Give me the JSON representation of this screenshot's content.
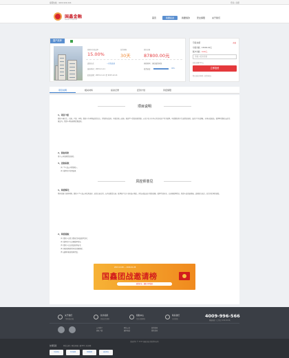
{
  "topbar": {
    "left": "客服热线：4009-996-566",
    "right": "登录 | 注册"
  },
  "brand": {
    "name": "国鑫金融",
    "sub": "Guoxin Financial"
  },
  "nav": [
    "首页",
    "我要投资",
    "我要借款",
    "安全保障",
    "关于我们"
  ],
  "product": {
    "tag": "国产抵押",
    "rate_label": "预期年化收益率",
    "rate": "15.00%",
    "term_label": "投资期限",
    "term": "30天",
    "amount_label": "借款金额",
    "amount": "87800.00元",
    "repay_label": "还款方式",
    "repay_value": "一次性还款",
    "guarantee_label": "担保机构：国信融资担保",
    "progress_label": "投资进度",
    "progress": 0.99,
    "progress_text": "99%",
    "release_label": "发布时间：2015-11-11",
    "date_range": "起息日期：2015-11-11 至 2015-12-11"
  },
  "invest": {
    "title": "可投余额",
    "recharge": "充值",
    "balance": "可投余额：15000.00元",
    "account_prefix": "账户余额：",
    "account_value": "0.00元",
    "placeholder": "请输入投资金额",
    "hint": "起投金额100元",
    "button": "立即投资",
    "agree": "我已阅读并同意《投资协议》"
  },
  "tabs": [
    "项目说明",
    "相关材料",
    "投资记录",
    "还款计划",
    "风控保障"
  ],
  "section1": {
    "title": "项目说明",
    "h1": "1、项目介绍",
    "p1": "借款人杨先生，已婚，户籍：本地。借款人为本地私营企业主，经营状况良好，有稳定收入来源。现因个人资金周转需要，以名下位于市中心的住宅房产作为抵押，申请借款用于生意资金周转。该房产产权清晰，市场价值较高，抵押率控制在安全范围之内，借款人承诺按期足额还款。",
    "h2": "2、资金用途",
    "p2": "用于公司短期资金周转。",
    "h3": "3、还款来源：",
    "r1": "(1) 个人及公司经营收入",
    "r2": "(2) 抵押房产处置变现"
  },
  "section2": {
    "title": "风控师意见",
    "h1": "1、风控情况：",
    "p1": "经风控部门实地考察，借款人个人及公司信用良好，征信记录正常，无不良借贷记录。抵押房产位于市区核心地段，评估价值远高于借款金额，抵押手续齐全，已办理抵押登记。借款人还款意愿强，还款能力充足，综合评定风险较低。",
    "h2": "2、风控措施：",
    "c1": "(1) 借款人已签订借款合同及抵押合同；",
    "c2": "(2) 抵押房产已办理抵押登记；",
    "c3": "(3) 借款人已出具还款承诺书；",
    "c4": "(4) 担保机构提供本息全额担保；",
    "c5": "(5) 逾期时担保机构代偿。"
  },
  "banner": {
    "date": "2015.12.08 — 2016.01.08",
    "text": "国鑫团战邀请榜",
    "sub": "邀请好友 · 赢取丰厚奖励"
  },
  "footer": {
    "i1": "关于我们",
    "i1s": "了解国鑫金融",
    "i2": "新手指南",
    "i2s": "轻松投资理财",
    "i3": "帮助中心",
    "i3s": "常见问题解答",
    "i4": "联系我们",
    "i4s": "在线客服",
    "phone": "4009-996-566",
    "phone_sub": "客服热线（工作日 9:00-18:00）",
    "col1": [
      "公司简介",
      "团队介绍"
    ],
    "col2": [
      "网站公告",
      "媒体报道"
    ],
    "col3": [
      "投资指南",
      "借款指南"
    ]
  },
  "bottom": {
    "copy": "版权所有 © 2015 国鑫金融 保留所有权利",
    "links_label": "友情链接",
    "links": "网贷之家  |  网贷天眼  |  融360  |  和讯网",
    "b1": "可信网站",
    "b2": "安全联盟",
    "b3": "网络警察",
    "b4": "诚信网站"
  }
}
